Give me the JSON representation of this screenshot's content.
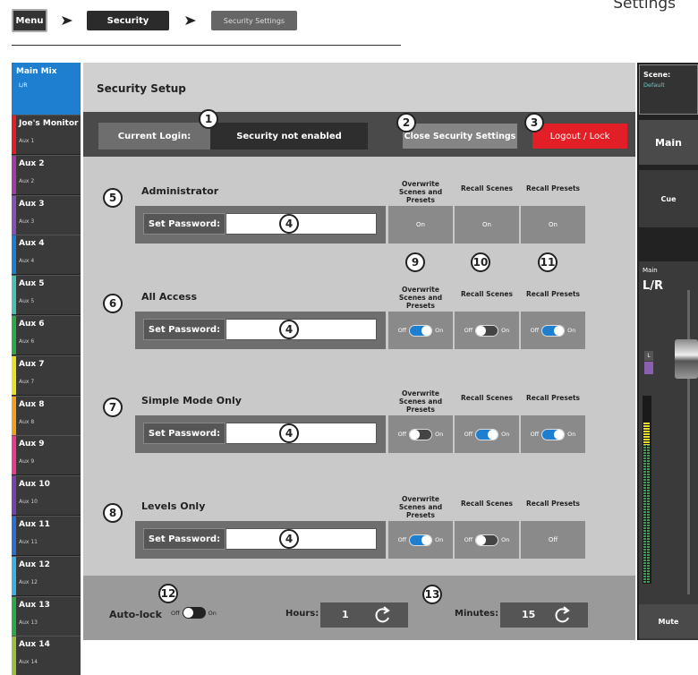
{
  "breadcrumb": {
    "menu": "Menu",
    "security": "Security",
    "security_settings": "Security Settings",
    "top_right": "Settings"
  },
  "sidebar": {
    "main": {
      "label": "Main Mix",
      "sub": "L/R"
    },
    "items": [
      {
        "label": "Joe's Monitor",
        "sub": "Aux 1",
        "color": "#e21f26"
      },
      {
        "label": "Aux 2",
        "sub": "Aux 2",
        "color": "#9b3fa0"
      },
      {
        "label": "Aux 3",
        "sub": "Aux 3",
        "color": "#8a4fb5"
      },
      {
        "label": "Aux 4",
        "sub": "Aux 4",
        "color": "#1e7fd0"
      },
      {
        "label": "Aux 5",
        "sub": "Aux 5",
        "color": "#4cc0b0"
      },
      {
        "label": "Aux 6",
        "sub": "Aux 6",
        "color": "#2fa84a"
      },
      {
        "label": "Aux 7",
        "sub": "Aux 7",
        "color": "#e8e020"
      },
      {
        "label": "Aux 8",
        "sub": "Aux 8",
        "color": "#f0a020"
      },
      {
        "label": "Aux 9",
        "sub": "Aux 9",
        "color": "#e83c8c"
      },
      {
        "label": "Aux 10",
        "sub": "Aux 10",
        "color": "#7a3fb0"
      },
      {
        "label": "Aux 11",
        "sub": "Aux 11",
        "color": "#2f6fd0"
      },
      {
        "label": "Aux 12",
        "sub": "Aux 12",
        "color": "#3fb0e0"
      },
      {
        "label": "Aux 13",
        "sub": "Aux 13",
        "color": "#2fa84a"
      },
      {
        "label": "Aux 14",
        "sub": "Aux 14",
        "color": "#9ac040"
      }
    ]
  },
  "header": {
    "title": "Security Setup"
  },
  "login": {
    "label": "Current Login:",
    "value": "Security not enabled",
    "close_button": "Close Security Settings",
    "logout_button": "Logout / Lock"
  },
  "columns": {
    "overwrite": "Overwrite Scenes and Presets",
    "recall_scenes": "Recall Scenes",
    "recall_presets": "Recall Presets"
  },
  "toggle_text": {
    "off": "Off",
    "on": "On"
  },
  "roles": [
    {
      "name": "Administrator",
      "password_label": "Set Password:",
      "overwrite": "On",
      "recall_scenes": "On",
      "recall_presets": "On"
    },
    {
      "name": "All Access",
      "password_label": "Set Password:",
      "overwrite": true,
      "recall_scenes": false,
      "recall_presets": true
    },
    {
      "name": "Simple Mode Only",
      "password_label": "Set Password:",
      "overwrite": false,
      "recall_scenes": true,
      "recall_presets": true
    },
    {
      "name": "Levels Only",
      "password_label": "Set Password:",
      "overwrite": true,
      "recall_scenes": false,
      "recall_presets": "Off"
    }
  ],
  "callouts": {
    "c1": "1",
    "c2": "2",
    "c3": "3",
    "c4": "4",
    "c5": "5",
    "c6": "6",
    "c7": "7",
    "c8": "8",
    "c9": "9",
    "c10": "10",
    "c11": "11",
    "c12": "12",
    "c13": "13"
  },
  "autolock": {
    "label": "Auto-lock",
    "state": false
  },
  "timer": {
    "hours_label": "Hours:",
    "hours": "1",
    "minutes_label": "Minutes:",
    "minutes": "15"
  },
  "right_panel": {
    "scene_label": "Scene:",
    "scene_value": "Default",
    "main_button": "Main",
    "cue_button": "Cue",
    "main_small": "Main",
    "main_big": "L/R",
    "l_label": "L",
    "mute_button": "Mute"
  }
}
